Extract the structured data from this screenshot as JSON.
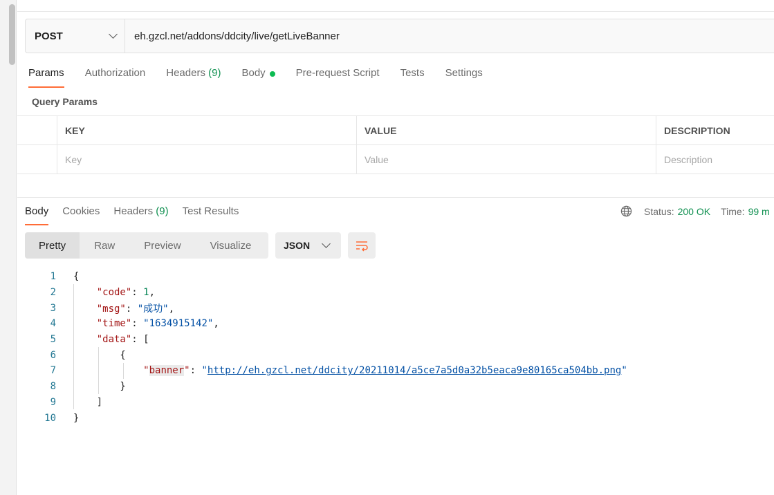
{
  "request": {
    "method": "POST",
    "url": "eh.gzcl.net/addons/ddcity/live/getLiveBanner"
  },
  "req_tabs": {
    "params": "Params",
    "authorization": "Authorization",
    "headers": "Headers",
    "headers_count": "(9)",
    "body": "Body",
    "pre_request": "Pre-request Script",
    "tests": "Tests",
    "settings": "Settings"
  },
  "query_params": {
    "title": "Query Params",
    "columns": [
      "KEY",
      "VALUE",
      "DESCRIPTION"
    ],
    "placeholders": [
      "Key",
      "Value",
      "Description"
    ]
  },
  "res_tabs": {
    "body": "Body",
    "cookies": "Cookies",
    "headers": "Headers",
    "headers_count": "(9)",
    "test_results": "Test Results"
  },
  "status": {
    "status_label": "Status:",
    "status_value": "200 OK",
    "time_label": "Time:",
    "time_value": "99 m"
  },
  "view": {
    "pretty": "Pretty",
    "raw": "Raw",
    "preview": "Preview",
    "visualize": "Visualize",
    "format": "JSON"
  },
  "code": {
    "line_numbers": [
      "1",
      "2",
      "3",
      "4",
      "5",
      "6",
      "7",
      "8",
      "9",
      "10"
    ],
    "code_key": "\"code\"",
    "code_val": "1",
    "msg_key": "\"msg\"",
    "msg_val": "\"成功\"",
    "time_key": "\"time\"",
    "time_val": "\"1634915142\"",
    "data_key": "\"data\"",
    "banner_key": "banner",
    "banner_url": "http://eh.gzcl.net/ddcity/20211014/a5ce7a5d0a32b5eaca9e80165ca504bb.png"
  },
  "colors": {
    "accent": "#ff6c37",
    "success": "#0e8f4f",
    "body_dot": "#0cbb52"
  }
}
